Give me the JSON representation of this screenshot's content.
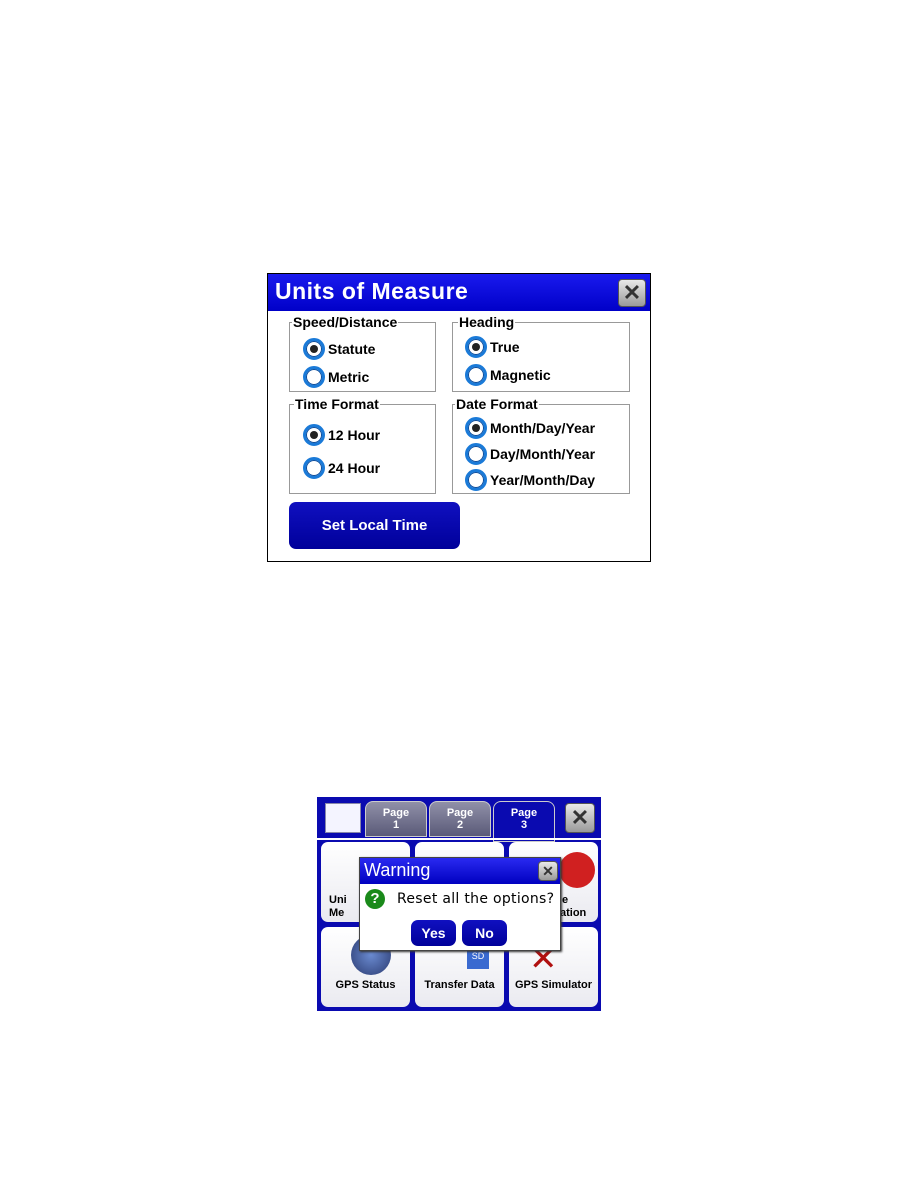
{
  "units_dialog": {
    "title": "Units of Measure",
    "close_icon": "close-x-icon",
    "groups": {
      "speed": {
        "label": "Speed/Distance",
        "options": [
          "Statute",
          "Metric"
        ],
        "selected": "Statute"
      },
      "heading": {
        "label": "Heading",
        "options": [
          "True",
          "Magnetic"
        ],
        "selected": "True"
      },
      "time": {
        "label": "Time Format",
        "options": [
          "12 Hour",
          "24 Hour"
        ],
        "selected": "12 Hour"
      },
      "date": {
        "label": "Date Format",
        "options": [
          "Month/Day/Year",
          "Day/Month/Year",
          "Year/Month/Day"
        ],
        "selected": "Month/Day/Year"
      }
    },
    "set_time_label": "Set Local Time"
  },
  "menu": {
    "tabs": [
      {
        "l1": "Page",
        "l2": "1"
      },
      {
        "l1": "Page",
        "l2": "2"
      },
      {
        "l1": "Page",
        "l2": "3"
      }
    ],
    "active_tab": "3",
    "tiles": {
      "t1a": "Uni",
      "t1b": "Me",
      "t3a": "e",
      "t3b": "ation",
      "gps_status": "GPS Status",
      "transfer": "Transfer Data",
      "simulator": "GPS Simulator"
    },
    "warning": {
      "title": "Warning",
      "message": "Reset all the options?",
      "yes": "Yes",
      "no": "No"
    }
  },
  "colors": {
    "title_bar": "#0000c8",
    "radio": "#1a7ad8",
    "question": "#1a8a1a"
  }
}
